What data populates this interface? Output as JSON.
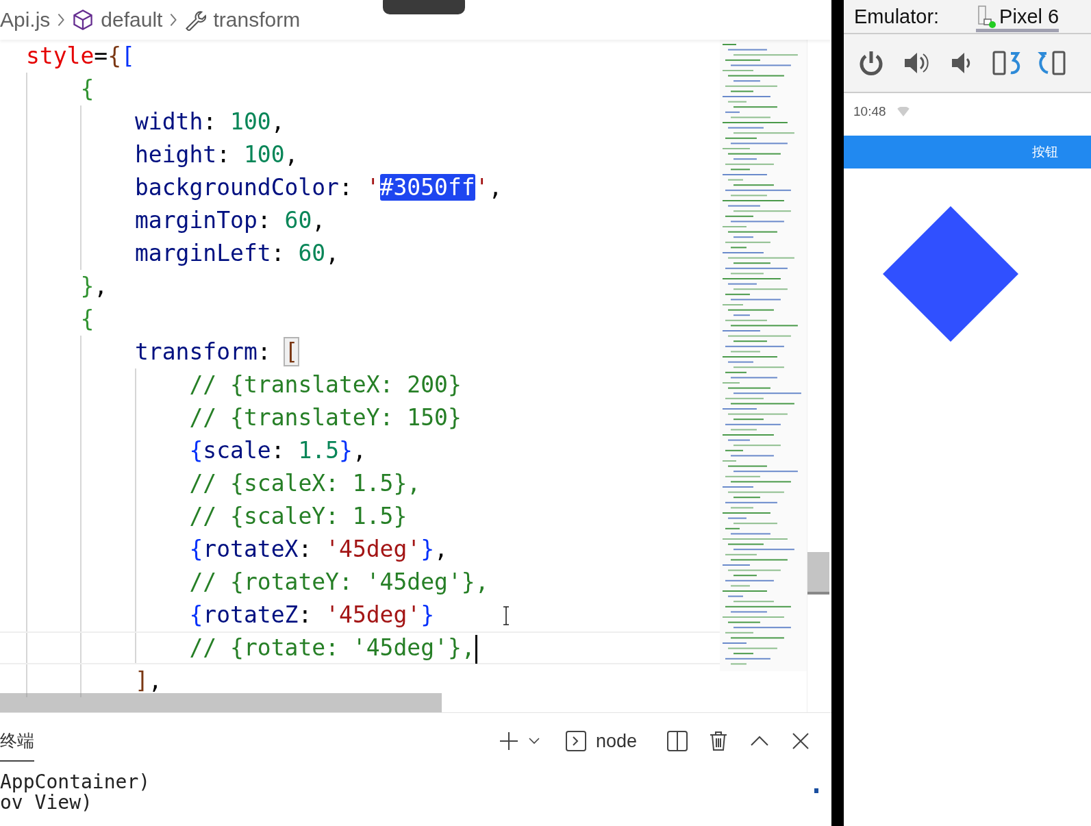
{
  "breadcrumb": [
    {
      "kind": "file",
      "label": "Api.js"
    },
    {
      "kind": "module",
      "label": "default"
    },
    {
      "kind": "function",
      "label": "transform"
    }
  ],
  "editor": {
    "lines": [
      {
        "current": false,
        "tokens": [
          {
            "kind": "attr",
            "text": "style"
          },
          {
            "kind": "punct",
            "text": "="
          },
          {
            "kind": "bracket",
            "text": "{",
            "color": "#7b3814"
          },
          {
            "kind": "bracket",
            "text": "[",
            "color": "#0431fa"
          }
        ],
        "children": [
          {
            "current": false,
            "tokens": [
              {
                "kind": "bracket",
                "text": "{",
                "color": "#319331"
              }
            ],
            "children": [
              {
                "current": false,
                "tokens": [
                  {
                    "kind": "prop",
                    "text": "width"
                  },
                  {
                    "kind": "punct",
                    "text": ": "
                  },
                  {
                    "kind": "number",
                    "text": "100"
                  },
                  {
                    "kind": "punct",
                    "text": ","
                  }
                ]
              },
              {
                "current": false,
                "tokens": [
                  {
                    "kind": "prop",
                    "text": "height"
                  },
                  {
                    "kind": "punct",
                    "text": ": "
                  },
                  {
                    "kind": "number",
                    "text": "100"
                  },
                  {
                    "kind": "punct",
                    "text": ","
                  }
                ]
              },
              {
                "current": false,
                "tokens": [
                  {
                    "kind": "prop",
                    "text": "backgroundColor"
                  },
                  {
                    "kind": "punct",
                    "text": ": "
                  },
                  {
                    "kind": "string",
                    "text": "'"
                  },
                  {
                    "kind": "selected",
                    "text": "#3050ff"
                  },
                  {
                    "kind": "string",
                    "text": "'"
                  },
                  {
                    "kind": "punct",
                    "text": ","
                  }
                ]
              },
              {
                "current": false,
                "tokens": [
                  {
                    "kind": "prop",
                    "text": "marginTop"
                  },
                  {
                    "kind": "punct",
                    "text": ": "
                  },
                  {
                    "kind": "number",
                    "text": "60"
                  },
                  {
                    "kind": "punct",
                    "text": ","
                  }
                ]
              },
              {
                "current": false,
                "tokens": [
                  {
                    "kind": "prop",
                    "text": "marginLeft"
                  },
                  {
                    "kind": "punct",
                    "text": ": "
                  },
                  {
                    "kind": "number",
                    "text": "60"
                  },
                  {
                    "kind": "punct",
                    "text": ","
                  }
                ]
              }
            ]
          },
          {
            "current": false,
            "tokens": [
              {
                "kind": "bracket",
                "text": "}",
                "color": "#319331"
              },
              {
                "kind": "punct",
                "text": ","
              }
            ]
          },
          {
            "current": false,
            "tokens": [
              {
                "kind": "bracket",
                "text": "{",
                "color": "#319331"
              }
            ],
            "children": [
              {
                "current": false,
                "tokens": [
                  {
                    "kind": "prop",
                    "text": "transform"
                  },
                  {
                    "kind": "punct",
                    "text": ": "
                  },
                  {
                    "kind": "match",
                    "text": "[",
                    "color": "#7b3814"
                  }
                ],
                "children": [
                  {
                    "current": false,
                    "tokens": [
                      {
                        "kind": "comment",
                        "text": "// {translateX: 200}"
                      }
                    ]
                  },
                  {
                    "current": false,
                    "tokens": [
                      {
                        "kind": "comment",
                        "text": "// {translateY: 150}"
                      }
                    ]
                  },
                  {
                    "current": false,
                    "tokens": [
                      {
                        "kind": "bracket",
                        "text": "{",
                        "color": "#0431fa"
                      },
                      {
                        "kind": "prop",
                        "text": "scale"
                      },
                      {
                        "kind": "punct",
                        "text": ": "
                      },
                      {
                        "kind": "number",
                        "text": "1.5"
                      },
                      {
                        "kind": "bracket",
                        "text": "}",
                        "color": "#0431fa"
                      },
                      {
                        "kind": "punct",
                        "text": ","
                      }
                    ]
                  },
                  {
                    "current": false,
                    "tokens": [
                      {
                        "kind": "comment",
                        "text": "// {scaleX: 1.5},"
                      }
                    ]
                  },
                  {
                    "current": false,
                    "tokens": [
                      {
                        "kind": "comment",
                        "text": "// {scaleY: 1.5}"
                      }
                    ]
                  },
                  {
                    "current": false,
                    "tokens": [
                      {
                        "kind": "bracket",
                        "text": "{",
                        "color": "#0431fa"
                      },
                      {
                        "kind": "prop",
                        "text": "rotateX"
                      },
                      {
                        "kind": "punct",
                        "text": ": "
                      },
                      {
                        "kind": "string",
                        "text": "'45deg'"
                      },
                      {
                        "kind": "bracket",
                        "text": "}",
                        "color": "#0431fa"
                      },
                      {
                        "kind": "punct",
                        "text": ","
                      }
                    ]
                  },
                  {
                    "current": false,
                    "tokens": [
                      {
                        "kind": "comment",
                        "text": "// {rotateY: '45deg'},"
                      }
                    ]
                  },
                  {
                    "current": false,
                    "tokens": [
                      {
                        "kind": "bracket",
                        "text": "{",
                        "color": "#0431fa"
                      },
                      {
                        "kind": "prop",
                        "text": "rotateZ"
                      },
                      {
                        "kind": "punct",
                        "text": ": "
                      },
                      {
                        "kind": "string",
                        "text": "'45deg'"
                      },
                      {
                        "kind": "bracket",
                        "text": "}",
                        "color": "#0431fa"
                      }
                    ]
                  },
                  {
                    "current": true,
                    "tokens": [
                      {
                        "kind": "comment",
                        "text": "// {rotate: '45deg'},"
                      }
                    ]
                  }
                ]
              },
              {
                "current": false,
                "tokens": [
                  {
                    "kind": "bracket",
                    "text": "]",
                    "color": "#7b3814"
                  },
                  {
                    "kind": "punct",
                    "text": ","
                  }
                ]
              }
            ]
          }
        ]
      }
    ]
  },
  "panel": {
    "tabs": [
      {
        "label": "终端",
        "selected": true
      }
    ],
    "shell": "node",
    "output": [
      "AppContainer)",
      "ov View)"
    ]
  },
  "emulator": {
    "title": "Emulator:",
    "devices": [
      {
        "label": "Pixel 6",
        "selected": true,
        "online": true
      }
    ],
    "status_time": "10:48",
    "button": "按钮"
  }
}
